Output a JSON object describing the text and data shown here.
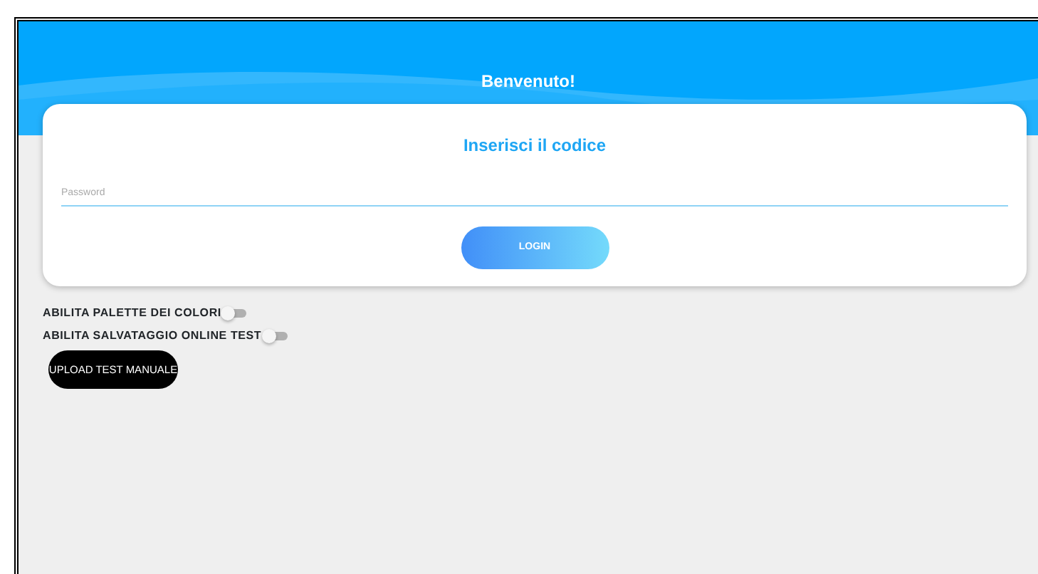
{
  "header": {
    "title": "Benvenuto!"
  },
  "login_card": {
    "title": "Inserisci il codice",
    "password": {
      "placeholder": "Password"
    },
    "button": "LOGIN"
  },
  "toggles": [
    {
      "label": "ABILITA PALETTE DEI COLORI",
      "on": false
    },
    {
      "label": "ABILITA SALVATAGGIO ONLINE TEST",
      "on": false
    }
  ],
  "upload_button": "UPLOAD TEST MANUALE"
}
